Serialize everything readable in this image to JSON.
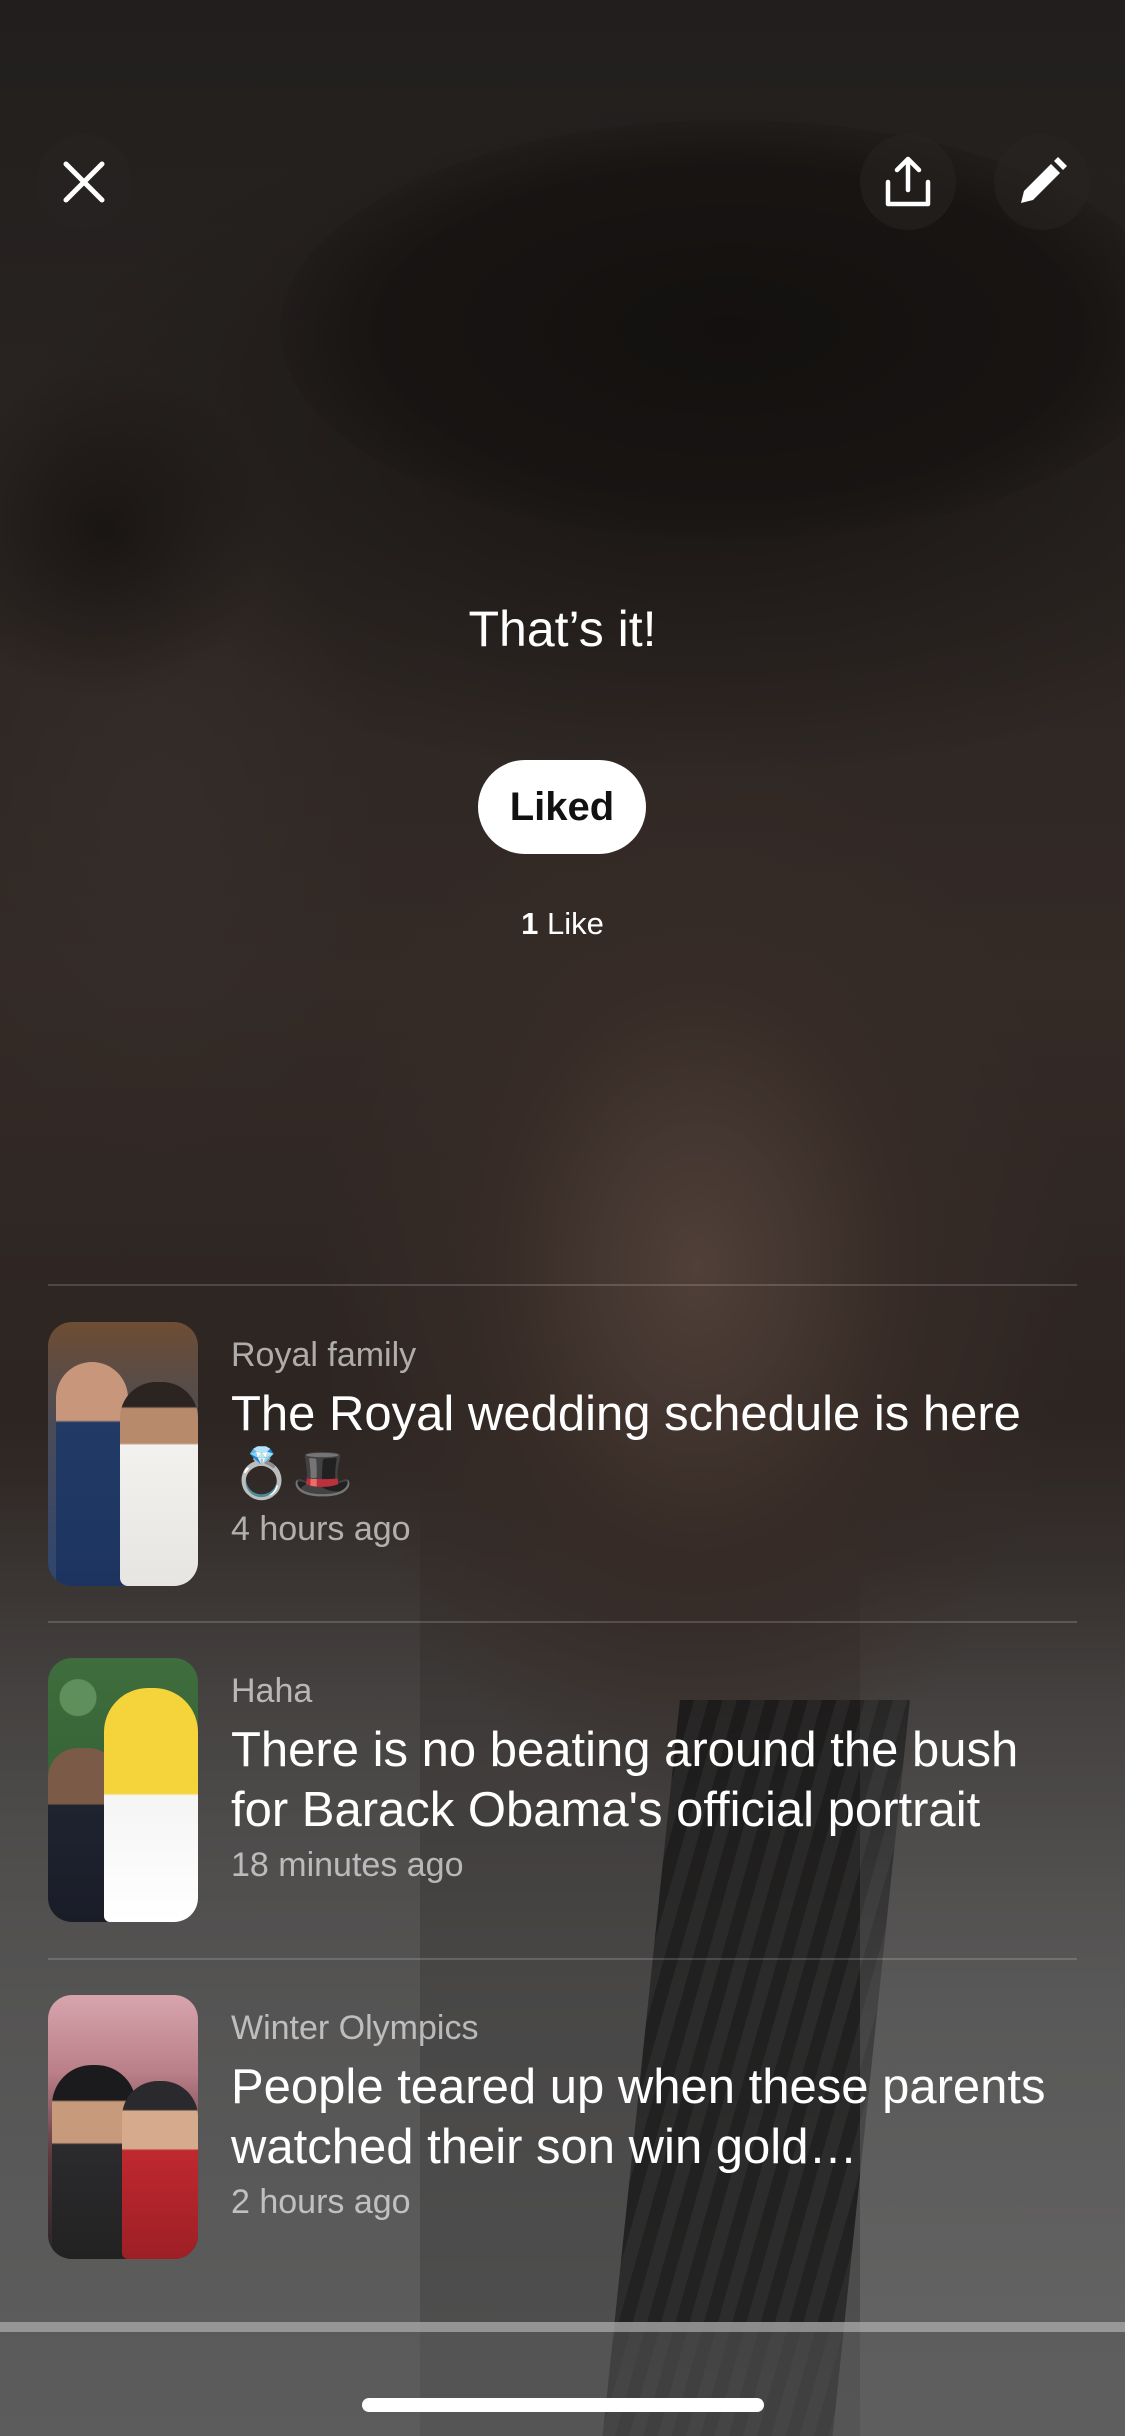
{
  "header": {
    "close_icon": "close-icon",
    "share_icon": "share-upload-icon",
    "edit_icon": "pencil-edit-icon"
  },
  "end_card": {
    "title": "That’s it!",
    "liked_button_label": "Liked",
    "like_count": "1",
    "like_count_label": "Like"
  },
  "stories": [
    {
      "category": "Royal family",
      "title": "The Royal wedding schedule is here 💍🎩",
      "time": "4 hours ago"
    },
    {
      "category": "Haha",
      "title": "There is no beating around the bush for Barack Obama's official portrait",
      "time": "18 minutes ago"
    },
    {
      "category": "Winter Olympics",
      "title": "People teared up when these parents watched their son win gold…",
      "time": "2 hours ago"
    }
  ]
}
